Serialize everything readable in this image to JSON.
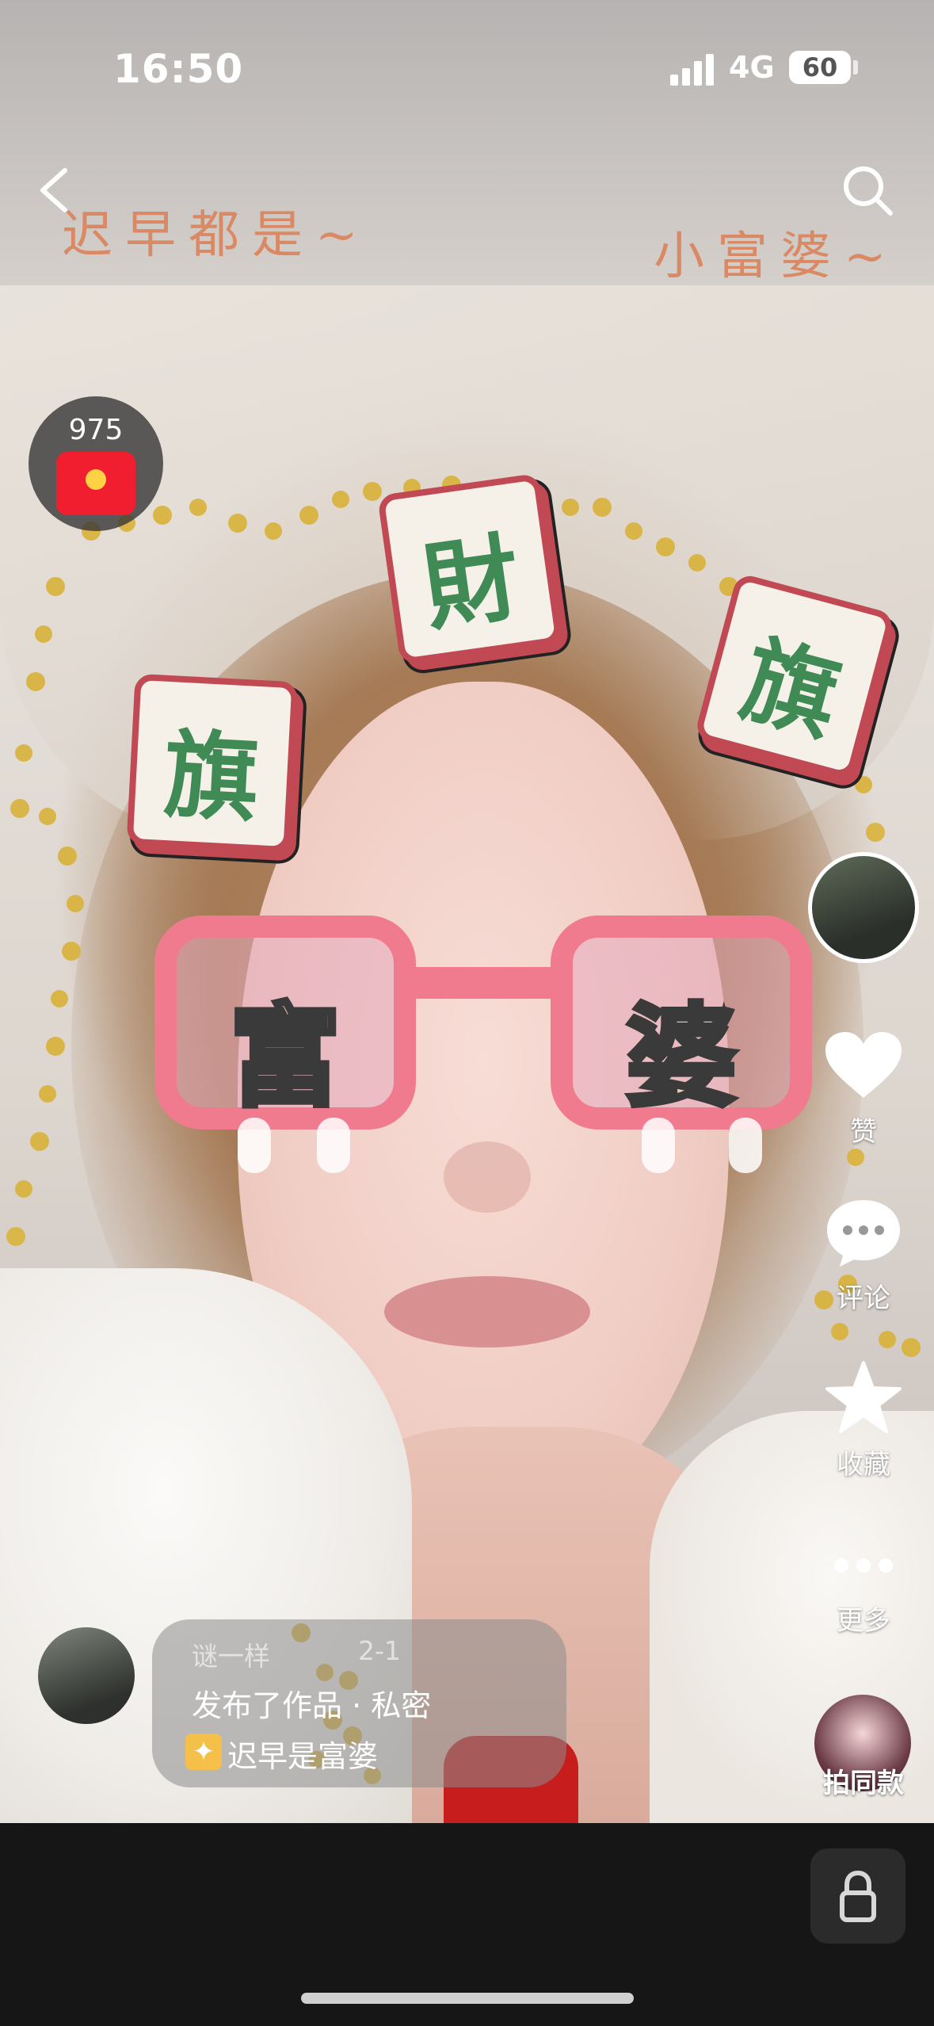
{
  "status_bar": {
    "time": "16:50",
    "network": "4G",
    "battery": "60"
  },
  "overlay_text": {
    "left": "迟早都是~",
    "right": "小富婆~"
  },
  "red_packet": {
    "count": "975"
  },
  "filter": {
    "tiles": [
      "旗",
      "財",
      "旗"
    ],
    "glasses": [
      "富",
      "婆"
    ]
  },
  "sidebar": {
    "like_label": "赞",
    "comment_label": "评论",
    "favorite_label": "收藏",
    "more_label": "更多"
  },
  "post": {
    "username": "谜一样",
    "date": "2-1",
    "status": "发布了作品 · 私密",
    "title": "迟早是富婆"
  },
  "same_style_label": "拍同款",
  "colors": {
    "accent_red": "#f01e2e",
    "tile_green": "#3f8a55",
    "glasses_pink": "#f07b8f"
  }
}
